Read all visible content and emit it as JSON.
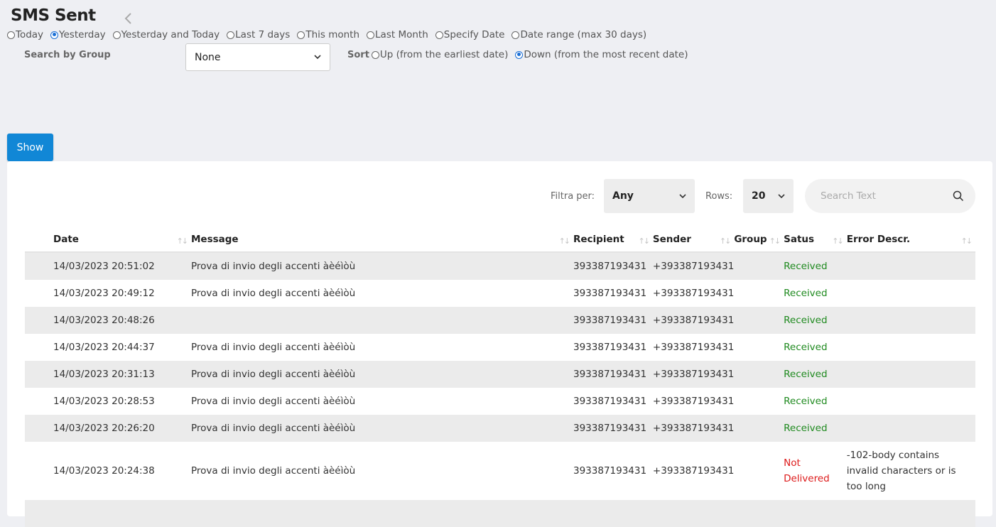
{
  "title": "SMS Sent",
  "period_options": [
    {
      "label": "Today",
      "checked": false
    },
    {
      "label": "Yesterday",
      "checked": true
    },
    {
      "label": "Yesterday and Today",
      "checked": false
    },
    {
      "label": "Last 7 days",
      "checked": false
    },
    {
      "label": "This month",
      "checked": false
    },
    {
      "label": "Last Month",
      "checked": false
    },
    {
      "label": "Specify Date",
      "checked": false
    },
    {
      "label": "Date range (max 30 days)",
      "checked": false
    }
  ],
  "search_group": {
    "label": "Search by Group",
    "value": "None"
  },
  "sort": {
    "label": "Sort",
    "options": [
      {
        "label": "Up (from the earliest date)",
        "checked": false
      },
      {
        "label": "Down (from the most recent date)",
        "checked": true
      }
    ]
  },
  "show_label": "Show",
  "toolbar": {
    "filter_label": "Filtra per:",
    "filter_value": "Any",
    "rows_label": "Rows:",
    "rows_value": "20",
    "search_placeholder": "Search Text"
  },
  "table": {
    "headers": [
      "Date",
      "Message",
      "Recipient",
      "Sender",
      "Group",
      "Satus",
      "Error Descr."
    ],
    "rows": [
      {
        "date": "14/03/2023 20:51:02",
        "message": "Prova di invio degli accenti àèéìòù",
        "recipient": "393387193431",
        "sender": "+393387193431",
        "group": "",
        "status": "Received",
        "error": ""
      },
      {
        "date": "14/03/2023 20:49:12",
        "message": "Prova di invio degli accenti àèéìòù",
        "recipient": "393387193431",
        "sender": "+393387193431",
        "group": "",
        "status": "Received",
        "error": ""
      },
      {
        "date": "14/03/2023 20:48:26",
        "message": "",
        "recipient": "393387193431",
        "sender": "+393387193431",
        "group": "",
        "status": "Received",
        "error": ""
      },
      {
        "date": "14/03/2023 20:44:37",
        "message": "Prova di invio degli accenti àèéìòù",
        "recipient": "393387193431",
        "sender": "+393387193431",
        "group": "",
        "status": "Received",
        "error": ""
      },
      {
        "date": "14/03/2023 20:31:13",
        "message": "Prova di invio degli accenti àèéìòù",
        "recipient": "393387193431",
        "sender": "+393387193431",
        "group": "",
        "status": "Received",
        "error": ""
      },
      {
        "date": "14/03/2023 20:28:53",
        "message": "Prova di invio degli accenti àèéìòù",
        "recipient": "393387193431",
        "sender": "+393387193431",
        "group": "",
        "status": "Received",
        "error": ""
      },
      {
        "date": "14/03/2023 20:26:20",
        "message": "Prova di invio degli accenti àèéìòù",
        "recipient": "393387193431",
        "sender": "+393387193431",
        "group": "",
        "status": "Received",
        "error": ""
      },
      {
        "date": "14/03/2023 20:24:38",
        "message": "Prova di invio degli accenti àèéìòù",
        "recipient": "393387193431",
        "sender": "+393387193431",
        "group": "",
        "status": "Not Delivered",
        "error": "-102-body contains invalid characters or is too long"
      }
    ]
  },
  "colors": {
    "accent": "#1187d6",
    "status_ok": "#1f8a1f",
    "status_bad": "#dd1a1a",
    "radio_checked": "#1a6fd6"
  }
}
